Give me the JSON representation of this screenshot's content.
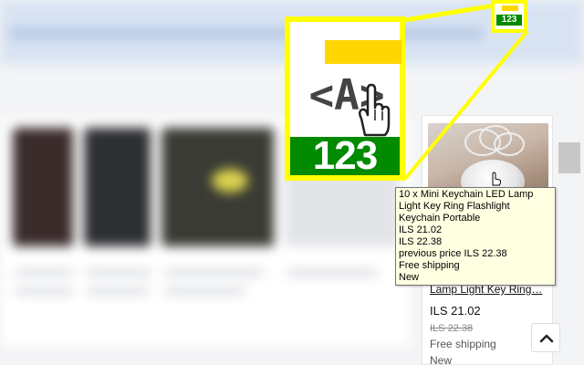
{
  "extension": {
    "icon_number": "123",
    "icon_code_glyph": "<A>",
    "colors": {
      "highlight": "#ffff00",
      "bar": "#ffd600",
      "badge": "#008a00"
    }
  },
  "product": {
    "title": "10 x Mini Keychain LED Lamp Light Key Ring…",
    "price": "ILS 21.02",
    "previous_price": "ILS 22.38",
    "shipping": "Free shipping",
    "condition": "New"
  },
  "tooltip": {
    "title": "10 x Mini Keychain LED Lamp Light Key Ring Flashlight Keychain Portable",
    "price": "ILS 21.02",
    "price2": "ILS 22.38",
    "previous_price": "previous price ILS 22.38",
    "shipping": "Free shipping",
    "condition": "New"
  },
  "icons": {
    "cursor": "hand-pointer-icon",
    "scroll_top": "chevron-up-icon"
  }
}
